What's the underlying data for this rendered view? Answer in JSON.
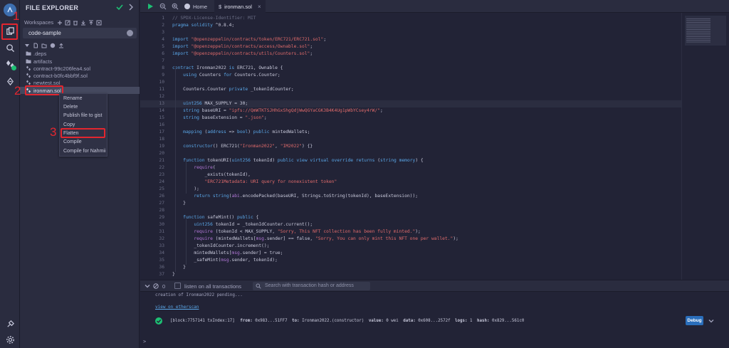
{
  "explorer": {
    "title": "FILE EXPLORER",
    "workspaces_label": "Workspaces",
    "workspace_name": "code-sample",
    "tree": [
      {
        "name": ".deps",
        "type": "folder"
      },
      {
        "name": "artifacts",
        "type": "folder"
      },
      {
        "name": "contract-99c206fea4.sol",
        "type": "file"
      },
      {
        "name": "contract-b0fc4bbf9f.sol",
        "type": "file"
      },
      {
        "name": "newtest.sol",
        "type": "file"
      },
      {
        "name": "ironman.sol",
        "type": "file",
        "selected": true
      }
    ]
  },
  "context_menu": [
    "Rename",
    "Delete",
    "Publish file to gist",
    "Copy",
    "Flatten",
    "Compile",
    "Compile for Nahmii"
  ],
  "annotations": [
    "1",
    "2",
    "3"
  ],
  "tabs": {
    "home": "Home",
    "active": "ironman.sol",
    "close": "×"
  },
  "code_lines": [
    {
      "n": "1",
      "t": "// SPDX-License-Identifier: MIT"
    },
    {
      "n": "2",
      "t": "pragma solidity ^0.8.4;"
    },
    {
      "n": "3",
      "t": ""
    },
    {
      "n": "4",
      "t": "import \"@openzeppelin/contracts/token/ERC721/ERC721.sol\";"
    },
    {
      "n": "5",
      "t": "import \"@openzeppelin/contracts/access/Ownable.sol\";"
    },
    {
      "n": "6",
      "t": "import \"@openzeppelin/contracts/utils/Counters.sol\";"
    },
    {
      "n": "7",
      "t": ""
    },
    {
      "n": "8",
      "t": "contract Ironman2022 is ERC721, Ownable {"
    },
    {
      "n": "9",
      "t": "    using Counters for Counters.Counter;"
    },
    {
      "n": "10",
      "t": ""
    },
    {
      "n": "11",
      "t": "    Counters.Counter private _tokenIdCounter;"
    },
    {
      "n": "12",
      "t": ""
    },
    {
      "n": "13",
      "t": "    uint256 MAX_SUPPLY = 30;"
    },
    {
      "n": "14",
      "t": "    string baseURI = \"ipfs://QmWTKTSJHhGxShgQdjWwQGYaCGK3B4K4Ug1pWbYCsey4rW/\";"
    },
    {
      "n": "15",
      "t": "    string baseExtension = \".json\";"
    },
    {
      "n": "16",
      "t": ""
    },
    {
      "n": "17",
      "t": "    mapping (address => bool) public mintedWallets;"
    },
    {
      "n": "18",
      "t": ""
    },
    {
      "n": "19",
      "t": "    constructor() ERC721(\"Ironman2022\", \"IM2022\") {}"
    },
    {
      "n": "20",
      "t": ""
    },
    {
      "n": "21",
      "t": "    function tokenURI(uint256 tokenId) public view virtual override returns (string memory) {"
    },
    {
      "n": "22",
      "t": "        require("
    },
    {
      "n": "23",
      "t": "            _exists(tokenId),"
    },
    {
      "n": "24",
      "t": "            \"ERC721Metadata: URI query for nonexistent token\""
    },
    {
      "n": "25",
      "t": "        );"
    },
    {
      "n": "26",
      "t": "        return string(abi.encodePacked(baseURI, Strings.toString(tokenId), baseExtension));"
    },
    {
      "n": "27",
      "t": "    }"
    },
    {
      "n": "28",
      "t": ""
    },
    {
      "n": "29",
      "t": "    function safeMint() public {"
    },
    {
      "n": "30",
      "t": "        uint256 tokenId = _tokenIdCounter.current();"
    },
    {
      "n": "31",
      "t": "        require (tokenId < MAX_SUPPLY, \"Sorry, This NFT collection has been fully minted.\");"
    },
    {
      "n": "32",
      "t": "        require (mintedWallets[msg.sender] == false, \"Sorry, You can only mint this NFT one per wallet.\");"
    },
    {
      "n": "33",
      "t": "        _tokenIdCounter.increment();"
    },
    {
      "n": "34",
      "t": "        mintedWallets[msg.sender] = true;"
    },
    {
      "n": "35",
      "t": "        _safeMint(msg.sender, tokenId);"
    },
    {
      "n": "36",
      "t": "    }"
    },
    {
      "n": "37",
      "t": "}"
    }
  ],
  "current_line": 13,
  "terminal": {
    "count": "0",
    "listen_label": "listen on all transactions",
    "search_placeholder": "Search with transaction hash or address",
    "pending_text": "creation of Ironman2022 pending...",
    "etherscan_link": "view on etherscan",
    "log_block": "[block:7757141 txIndex:17]",
    "log_from_label": "from:",
    "log_from": "0x983...51FF7",
    "log_to_label": "to:",
    "log_to": "Ironman2022.(constructor)",
    "log_value_label": "value:",
    "log_value": "0 wei",
    "log_data_label": "data:",
    "log_data": "0x608...2572f",
    "log_logs_label": "logs:",
    "log_logs": "1",
    "log_hash_label": "hash:",
    "log_hash": "0x829...561c0",
    "debug_label": "Debug",
    "prompt": ">"
  },
  "colors": {
    "annotation_red": "#e3262f",
    "success_green": "#1dbf73",
    "accent_blue": "#2a6ebb"
  }
}
